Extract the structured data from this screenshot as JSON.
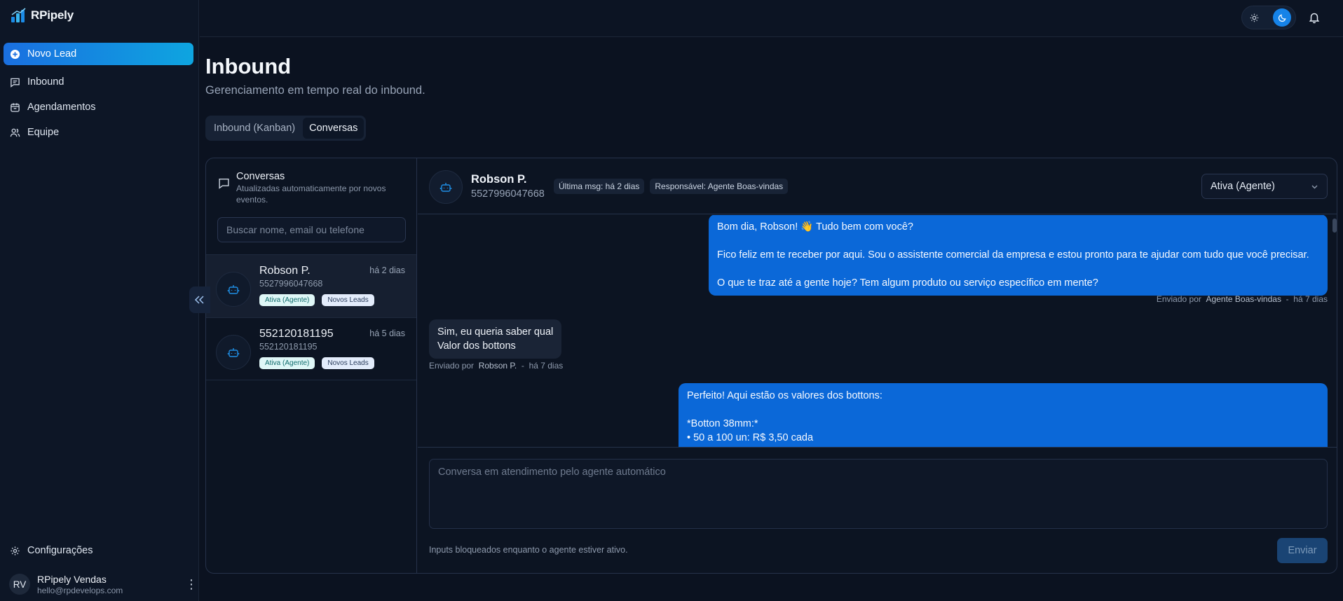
{
  "app": {
    "name": "RPipely"
  },
  "sidebar": {
    "primary": {
      "label": "Novo Lead",
      "icon": "plus-circle-icon"
    },
    "items": [
      {
        "label": "Inbound",
        "icon": "message-square-icon"
      },
      {
        "label": "Agendamentos",
        "icon": "calendar-icon"
      },
      {
        "label": "Equipe",
        "icon": "users-icon"
      }
    ],
    "settings": {
      "label": "Configurações",
      "icon": "gear-icon"
    },
    "user": {
      "initials": "RV",
      "name": "RPipely Vendas",
      "email": "hello@rpdevelops.com"
    }
  },
  "topbar": {
    "theme": "dark"
  },
  "page": {
    "title": "Inbound",
    "subtitle": "Gerenciamento em tempo real do inbound.",
    "tabs": [
      {
        "label": "Inbound (Kanban)",
        "active": false
      },
      {
        "label": "Conversas",
        "active": true
      }
    ]
  },
  "conversations": {
    "title": "Conversas",
    "description": "Atualizadas automaticamente por novos eventos.",
    "search_placeholder": "Buscar nome, email ou telefone",
    "items": [
      {
        "name": "Robson P.",
        "time": "há 2 dias",
        "phone": "5527996047668",
        "badges": [
          "Ativa (Agente)",
          "Novos Leads"
        ],
        "selected": true
      },
      {
        "name": "552120181195",
        "time": "há 5 dias",
        "phone": "552120181195",
        "badges": [
          "Ativa (Agente)",
          "Novos Leads"
        ],
        "selected": false
      }
    ]
  },
  "chat": {
    "name": "Robson P.",
    "phone": "5527996047668",
    "tags": [
      "Última msg: há 2 dias",
      "Responsável: Agente Boas-vindas"
    ],
    "status": "Ativa (Agente)",
    "messages": [
      {
        "direction": "out",
        "text": "Bom dia, Robson! 👋 Tudo bem com você?\n\nFico feliz em te receber por aqui. Sou o assistente comercial da empresa e estou pronto para te ajudar com tudo que você precisar.\n\nO que te traz até a gente hoje? Tem algum produto ou serviço específico em mente?",
        "sent_by_label": "Enviado por",
        "sender": "Agente Boas-vindas",
        "time": "há 7 dias"
      },
      {
        "direction": "in",
        "text": "Sim, eu queria saber qual\nValor dos bottons",
        "sent_by_label": "Enviado por",
        "sender": "Robson P.",
        "time": "há 7 dias"
      },
      {
        "direction": "out",
        "text": "Perfeito! Aqui estão os valores dos bottons:\n\n*Botton 38mm:*\n• 50 a 100 un: R$ 3,50 cada",
        "sent_by_label": "",
        "sender": "",
        "time": ""
      }
    ],
    "composer_placeholder": "Conversa em atendimento pelo agente automático",
    "composer_note": "Inputs bloqueados enquanto o agente estiver ativo.",
    "send_label": "Enviar"
  },
  "colors": {
    "accent": "#0b68d8",
    "primary_gradient_start": "#1a6fe0",
    "primary_gradient_end": "#0ea5e0"
  }
}
